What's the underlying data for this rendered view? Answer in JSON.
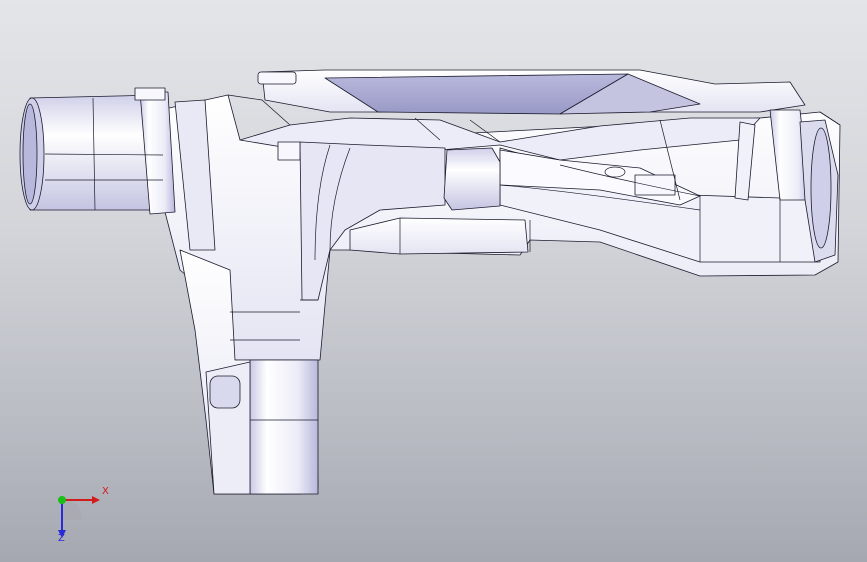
{
  "viewport": {
    "background_top": "#e3e5e9",
    "background_bottom": "#a5a8b0"
  },
  "model": {
    "fill_light": "#f4f4fb",
    "fill_mid": "#d9d9ee",
    "fill_dark": "#a8a8cf",
    "edge_color": "#1b1b2e"
  },
  "triad": {
    "x_label": "X",
    "z_label": "Z",
    "x_color": "#d21c1c",
    "y_color": "#18c018",
    "z_color": "#2a2ad6"
  }
}
